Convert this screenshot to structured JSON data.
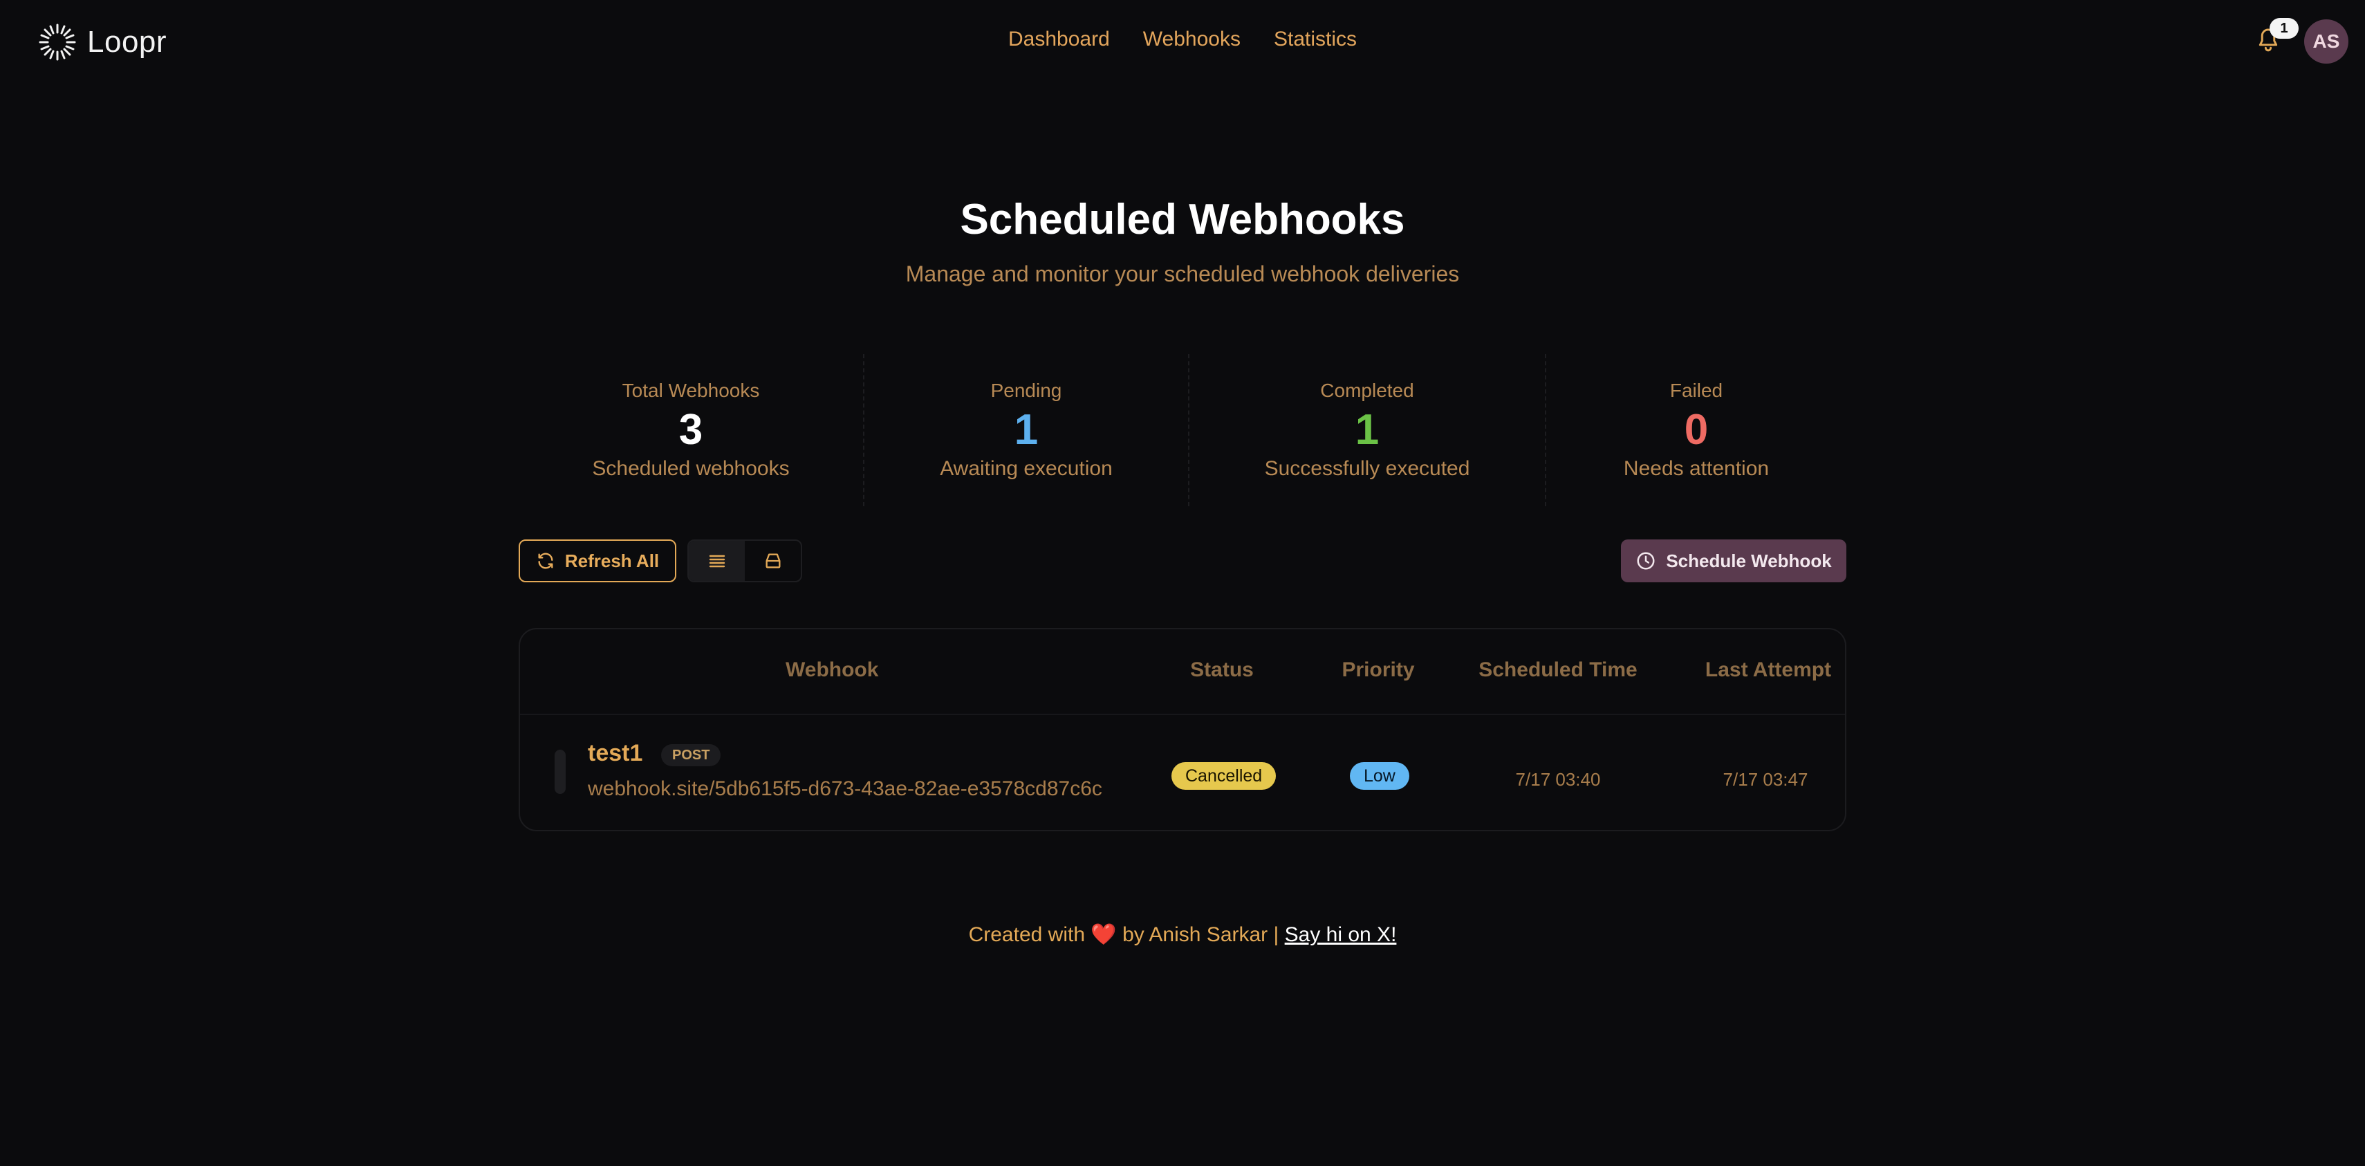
{
  "app": {
    "name": "Loopr"
  },
  "nav": {
    "links": [
      "Dashboard",
      "Webhooks",
      "Statistics"
    ]
  },
  "header": {
    "notification_count": "1",
    "avatar_initials": "AS"
  },
  "hero": {
    "title": "Scheduled Webhooks",
    "subtitle": "Manage and monitor your scheduled webhook deliveries"
  },
  "stats": [
    {
      "label": "Total Webhooks",
      "value": "3",
      "desc": "Scheduled webhooks",
      "color": "#ffffff"
    },
    {
      "label": "Pending",
      "value": "1",
      "desc": "Awaiting execution",
      "color": "#5db0ee"
    },
    {
      "label": "Completed",
      "value": "1",
      "desc": "Successfully executed",
      "color": "#6bc246"
    },
    {
      "label": "Failed",
      "value": "0",
      "desc": "Needs attention",
      "color": "#ef6b63"
    }
  ],
  "toolbar": {
    "refresh_label": "Refresh All",
    "schedule_label": "Schedule Webhook"
  },
  "table": {
    "columns": [
      "Webhook",
      "Status",
      "Priority",
      "Scheduled Time",
      "Last Attempt"
    ],
    "rows": [
      {
        "name": "test1",
        "method": "POST",
        "url": "webhook.site/5db615f5-d673-43ae-82ae-e3578cd87c6c",
        "status": "Cancelled",
        "priority": "Low",
        "scheduled_time": "7/17 03:40",
        "last_attempt": "7/17 03:47"
      }
    ]
  },
  "footer": {
    "prefix": "Created with",
    "heart": "❤️",
    "middle": "by Anish Sarkar |",
    "link": "Say hi on X!"
  }
}
